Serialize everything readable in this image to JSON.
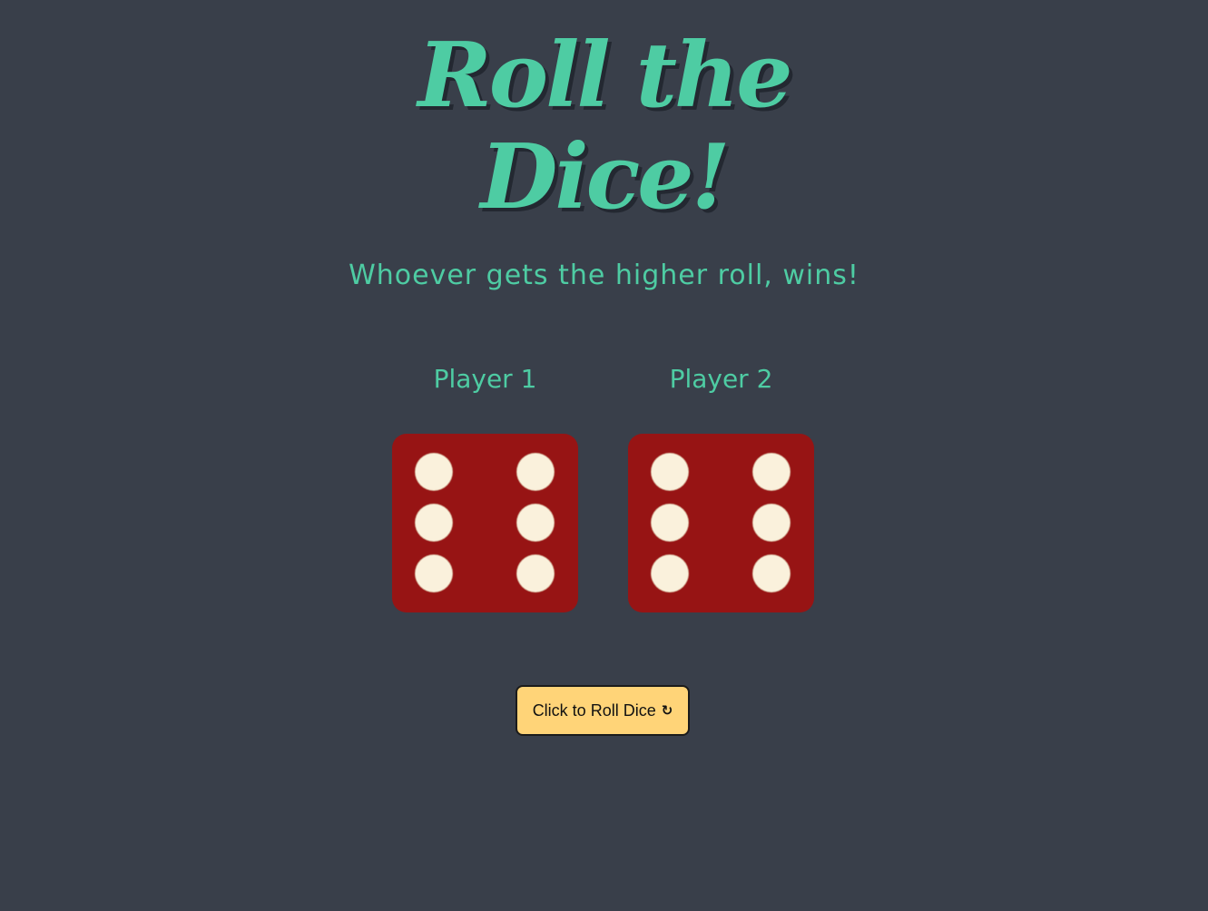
{
  "header": {
    "title_line1": "Roll the",
    "title_line2": "Dice!",
    "subtitle": "Whoever gets the higher roll, wins!"
  },
  "players": [
    {
      "label": "Player 1",
      "die_value": 6
    },
    {
      "label": "Player 2",
      "die_value": 6
    }
  ],
  "roll_button": {
    "label": "Click to Roll Dice",
    "icon": "refresh-icon",
    "icon_glyph": "↻"
  },
  "colors": {
    "background": "#393f4a",
    "accent": "#4ecca3",
    "die": "#971414",
    "pip": "#faf1dc",
    "button": "#ffd478"
  }
}
